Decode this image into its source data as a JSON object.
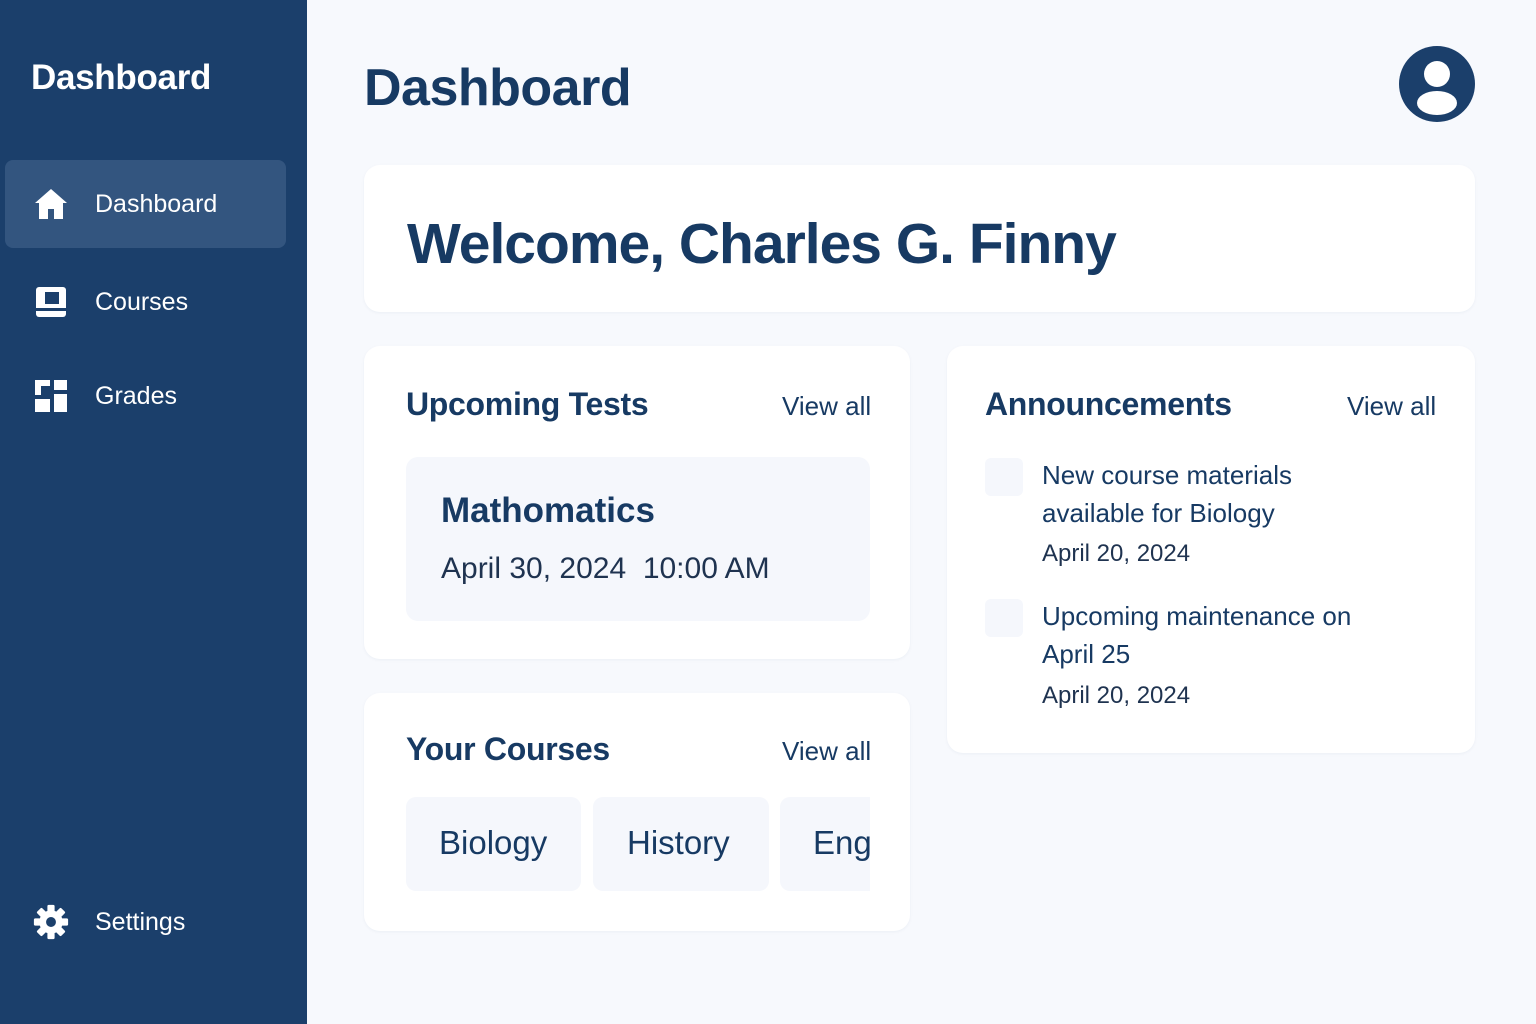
{
  "sidebar": {
    "title": "Dashboard",
    "items": [
      {
        "label": "Dashboard",
        "icon": "home-icon",
        "active": true
      },
      {
        "label": "Courses",
        "icon": "book-icon",
        "active": false
      },
      {
        "label": "Grades",
        "icon": "grades-icon",
        "active": false
      }
    ],
    "settings": {
      "label": "Settings",
      "icon": "gear-icon"
    }
  },
  "header": {
    "title": "Dashboard",
    "avatar_icon": "user-avatar-icon"
  },
  "welcome": {
    "text": "Welcome, Charles G. Finny"
  },
  "upcoming_tests": {
    "heading": "Upcoming Tests",
    "view_all": "View all",
    "items": [
      {
        "subject": "Mathomatics",
        "date": "April 30, 2024",
        "time": "10:00 AM"
      }
    ]
  },
  "your_courses": {
    "heading": "Your Courses",
    "view_all": "View all",
    "items": [
      "Biology",
      "History",
      "Eng"
    ]
  },
  "announcements": {
    "heading": "Announcements",
    "view_all": "View all",
    "items": [
      {
        "title": "New course materials available for Biology",
        "date": "April 20, 2024"
      },
      {
        "title": "Upcoming maintenance on April 25",
        "date": "April 20, 2024"
      }
    ]
  },
  "colors": {
    "sidebar_bg": "#1b3f6b",
    "active_item_bg": "#33557f",
    "accent_text": "#173a63",
    "page_bg": "#f7f9fd",
    "card_bg": "#ffffff"
  }
}
